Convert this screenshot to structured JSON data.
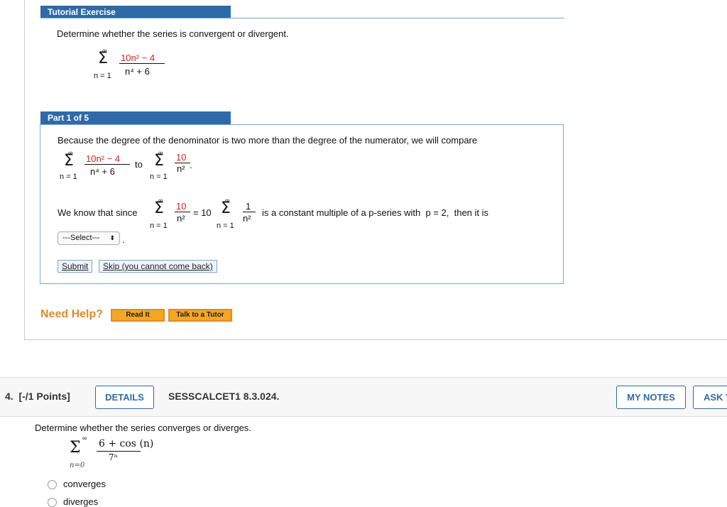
{
  "tutorial": {
    "title": "Tutorial Exercise",
    "prompt": "Determine whether the series is convergent or divergent.",
    "series": {
      "sum_upper": "∞",
      "sum_lower": "n = 1",
      "numerator": "10n² − 4",
      "denominator": "n⁴ + 6"
    }
  },
  "part": {
    "title": "Part 1 of 5",
    "text1": "Because the degree of the denominator is two more than the degree of the numerator, we will compare",
    "to": "to",
    "cmp_num": "10",
    "cmp_den": "n²",
    "text2_a": "We know that since",
    "equals10": "= 10",
    "one": "1",
    "text2_b": "is a constant multiple of a p-series with  p = 2,  then it is",
    "select_value": "---Select---",
    "submit_label": "Submit",
    "skip_label": "Skip (you cannot come back)"
  },
  "help": {
    "label": "Need Help?",
    "read_it": "Read It",
    "talk": "Talk to a Tutor"
  },
  "question4": {
    "number": "4.  [-/1 Points]",
    "details": "DETAILS",
    "code": "SESSCALCET1 8.3.024.",
    "my_notes": "MY NOTES",
    "ask": "ASK Y",
    "prompt": "Determine whether the series converges or diverges.",
    "numerator": "6 + cos (n)",
    "denominator": "7ⁿ",
    "sum_upper": "∞",
    "sum_lower": "n=0",
    "options": [
      "converges",
      "diverges"
    ]
  },
  "colors": {
    "header_blue": "#2f6aa8",
    "red": "#d62020",
    "orange": "#e08a2b"
  }
}
